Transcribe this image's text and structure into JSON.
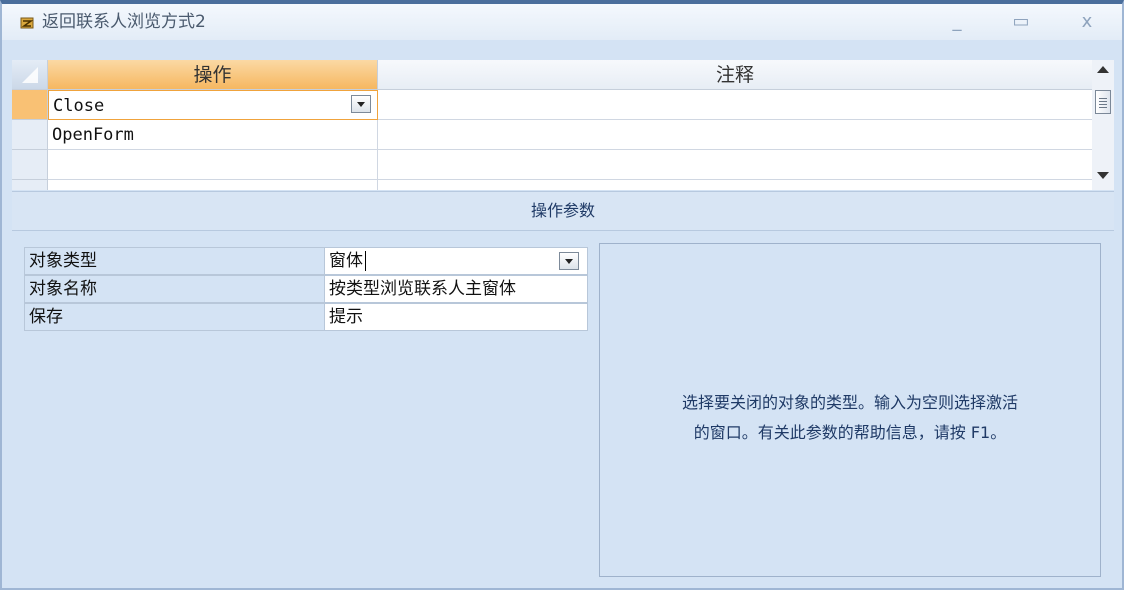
{
  "window": {
    "title": "返回联系人浏览方式2",
    "icon": "macro-icon",
    "minimize_label": "_",
    "maximize_label": "▭",
    "close_label": "x"
  },
  "grid": {
    "columns": [
      "操作",
      "注释"
    ],
    "rows": [
      {
        "action": "Close",
        "comment": ""
      },
      {
        "action": "OpenForm",
        "comment": ""
      },
      {
        "action": "",
        "comment": ""
      },
      {
        "action": "",
        "comment": ""
      }
    ]
  },
  "section_title": "操作参数",
  "params": [
    {
      "label": "对象类型",
      "value": "窗体"
    },
    {
      "label": "对象名称",
      "value": "按类型浏览联系人主窗体"
    },
    {
      "label": "保存",
      "value": "提示"
    }
  ],
  "help": {
    "line1": "选择要关闭的对象的类型。输入为空则选择激活",
    "line2": "的窗口。有关此参数的帮助信息，请按 F1。"
  },
  "colors": {
    "accent": "#f6b760",
    "panel": "#d4e3f4",
    "help_text": "#1f3a66"
  }
}
